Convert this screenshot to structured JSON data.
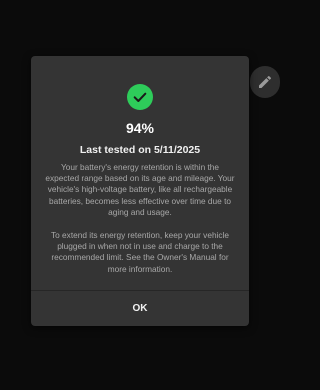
{
  "dialog": {
    "percent": "94%",
    "last_tested": "Last tested on 5/11/2025",
    "paragraph1": "Your battery's energy retention is within the expected range based on its age and mileage. Your vehicle's high-voltage battery, like all rechargeable batteries, becomes less effective over time due to aging and usage.",
    "paragraph2": "To extend its energy retention, keep your vehicle plugged in when not in use and charge to the recommended limit. See the Owner's Manual for more information.",
    "ok_label": "OK",
    "status_icon": "check-circle-icon"
  },
  "side_button": {
    "icon": "pencil-icon"
  },
  "colors": {
    "success": "#2ecc5a",
    "dialog_bg": "#343434",
    "page_bg": "#0b0b0b"
  }
}
